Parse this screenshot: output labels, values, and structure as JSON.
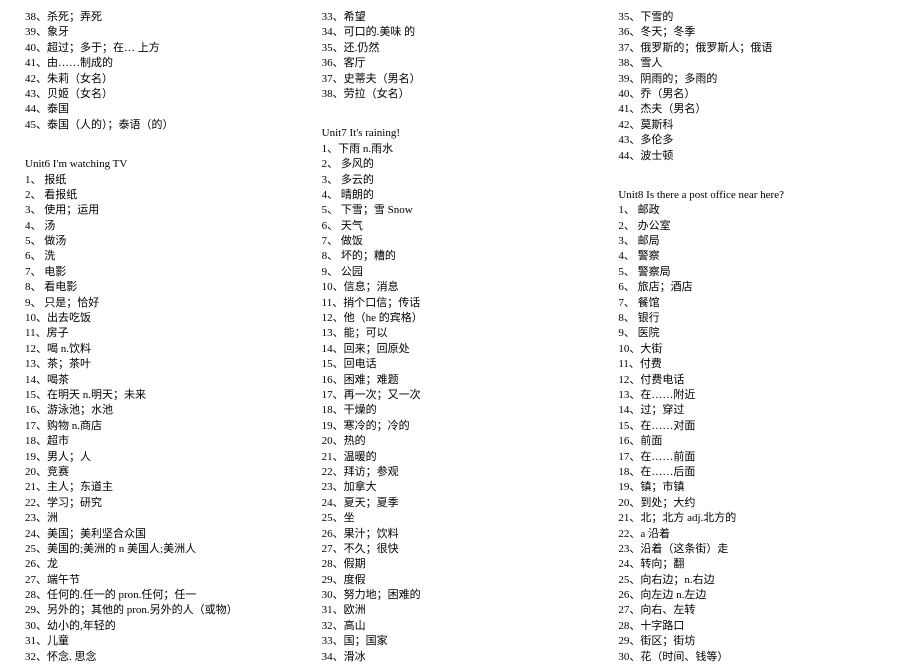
{
  "columns": [
    {
      "items": [
        {
          "type": "item",
          "text": "38、杀死；弄死"
        },
        {
          "type": "item",
          "text": "39、象牙"
        },
        {
          "type": "item",
          "text": "40、超过；多于；在… 上方"
        },
        {
          "type": "item",
          "text": "41、由……制成的"
        },
        {
          "type": "item",
          "text": "42、朱莉（女名）"
        },
        {
          "type": "item",
          "text": "43、贝姬（女名）"
        },
        {
          "type": "item",
          "text": "44、泰国"
        },
        {
          "type": "item",
          "text": "45、泰国（人的）；泰语（的）"
        },
        {
          "type": "spacer"
        },
        {
          "type": "unit",
          "text": "  Unit6   I'm watching TV"
        },
        {
          "type": "item",
          "text": "1、 报纸"
        },
        {
          "type": "item",
          "text": "2、 看报纸"
        },
        {
          "type": "item",
          "text": "3、 使用；运用"
        },
        {
          "type": "item",
          "text": "4、 汤"
        },
        {
          "type": "item",
          "text": "5、 做汤"
        },
        {
          "type": "item",
          "text": "6、 洗"
        },
        {
          "type": "item",
          "text": "7、 电影"
        },
        {
          "type": "item",
          "text": "8、 看电影"
        },
        {
          "type": "item",
          "text": "9、 只是；恰好"
        },
        {
          "type": "item",
          "text": "10、出去吃饭"
        },
        {
          "type": "item",
          "text": "11、房子"
        },
        {
          "type": "item",
          "text": "12、喝 n.饮料"
        },
        {
          "type": "item",
          "text": "13、茶；茶叶"
        },
        {
          "type": "item",
          "text": "14、喝茶"
        },
        {
          "type": "item",
          "text": "15、在明天   n.明天；未来"
        },
        {
          "type": "item",
          "text": "16、游泳池；水池"
        },
        {
          "type": "item",
          "text": "17、购物    n.商店"
        },
        {
          "type": "item",
          "text": "18、超市"
        },
        {
          "type": "item",
          "text": "19、男人；人"
        },
        {
          "type": "item",
          "text": "20、竞赛"
        },
        {
          "type": "item",
          "text": "21、主人；东道主"
        },
        {
          "type": "item",
          "text": "22、学习；研究"
        },
        {
          "type": "item",
          "text": "23、洲"
        },
        {
          "type": "item",
          "text": "24、美国；美利坚合众国"
        },
        {
          "type": "item",
          "text": "25、美国的;美洲的 n 美国人;美洲人"
        },
        {
          "type": "item",
          "text": "26、龙"
        },
        {
          "type": "item",
          "text": "27、端午节"
        },
        {
          "type": "item",
          "text": "28、任何的.任一的  pron.任何；任一"
        },
        {
          "type": "item",
          "text": "29、另外的；其他的 pron.另外的人（或物）"
        },
        {
          "type": "item",
          "text": "30、幼小的,年轻的"
        },
        {
          "type": "item",
          "text": "31、儿童"
        },
        {
          "type": "item",
          "text": "32、怀念. 思念"
        }
      ]
    },
    {
      "items": [
        {
          "type": "item",
          "text": "33、希望"
        },
        {
          "type": "item",
          "text": "34、可口的.美味 的"
        },
        {
          "type": "item",
          "text": "35、还.仍然"
        },
        {
          "type": "item",
          "text": "36、客厅"
        },
        {
          "type": "item",
          "text": "37、史蒂夫（男名）"
        },
        {
          "type": "item",
          "text": "38、劳拉（女名）"
        },
        {
          "type": "spacer"
        },
        {
          "type": "unit",
          "text": "Unit7    It's raining!"
        },
        {
          "type": "item",
          "text": "1、下雨 n.雨水"
        },
        {
          "type": "item",
          "text": "2、 多风的"
        },
        {
          "type": "item",
          "text": "3、 多云的"
        },
        {
          "type": "item",
          "text": "4、 晴朗的"
        },
        {
          "type": "item",
          "text": "5、 下雪；雪 Snow"
        },
        {
          "type": "item",
          "text": "6、 天气"
        },
        {
          "type": "item",
          "text": "7、 做饭"
        },
        {
          "type": "item",
          "text": "8、 坏的；糟的"
        },
        {
          "type": "item",
          "text": "9、 公园"
        },
        {
          "type": "item",
          "text": "10、信息；消息"
        },
        {
          "type": "item",
          "text": "11、捎个口信；传话"
        },
        {
          "type": "item",
          "text": "12、他（he 的宾格）"
        },
        {
          "type": "item",
          "text": "13、能；可以"
        },
        {
          "type": "item",
          "text": "14、回来；回原处"
        },
        {
          "type": "item",
          "text": "15、回电话"
        },
        {
          "type": "item",
          "text": "16、困难；难题"
        },
        {
          "type": "item",
          "text": "17、再一次；又一次"
        },
        {
          "type": "item",
          "text": "18、干燥的"
        },
        {
          "type": "item",
          "text": "19、寒冷的；冷的"
        },
        {
          "type": "item",
          "text": "20、热的"
        },
        {
          "type": "item",
          "text": "21、温暖的"
        },
        {
          "type": "item",
          "text": "22、拜访；参观"
        },
        {
          "type": "item",
          "text": "23、加拿大"
        },
        {
          "type": "item",
          "text": "24、夏天；夏季"
        },
        {
          "type": "item",
          "text": "25、坐"
        },
        {
          "type": "item",
          "text": "26、果汁；饮料"
        },
        {
          "type": "item",
          "text": "27、不久；很快"
        },
        {
          "type": "item",
          "text": "28、假期"
        },
        {
          "type": "item",
          "text": "29、度假"
        },
        {
          "type": "item",
          "text": "30、努力地；困难的"
        },
        {
          "type": "item",
          "text": "31、欧洲"
        },
        {
          "type": "item",
          "text": "32、高山"
        },
        {
          "type": "item",
          "text": "33、国；国家"
        },
        {
          "type": "item",
          "text": "34、滑冰"
        }
      ]
    },
    {
      "items": [
        {
          "type": "item",
          "text": "35、下雪的"
        },
        {
          "type": "item",
          "text": "36、冬天；冬季"
        },
        {
          "type": "item",
          "text": "37、俄罗斯的；俄罗斯人；俄语"
        },
        {
          "type": "item",
          "text": "38、雪人"
        },
        {
          "type": "item",
          "text": "39、阴雨的；多雨的"
        },
        {
          "type": "item",
          "text": "40、乔（男名）"
        },
        {
          "type": "item",
          "text": "41、杰夫（男名）"
        },
        {
          "type": "item",
          "text": "42、莫斯科"
        },
        {
          "type": "item",
          "text": "43、多伦多"
        },
        {
          "type": "item",
          "text": "44、波士顿"
        },
        {
          "type": "spacer"
        },
        {
          "type": "unit",
          "text": "Unit8    Is there a post office near here?"
        },
        {
          "type": "item",
          "text": "1、 邮政"
        },
        {
          "type": "item",
          "text": "2、 办公室"
        },
        {
          "type": "item",
          "text": "3、 邮局"
        },
        {
          "type": "item",
          "text": "4、 警察"
        },
        {
          "type": "item",
          "text": "5、 警察局"
        },
        {
          "type": "item",
          "text": "6、 旅店；酒店"
        },
        {
          "type": "item",
          "text": "7、 餐馆"
        },
        {
          "type": "item",
          "text": "8、 银行"
        },
        {
          "type": "item",
          "text": "9、 医院"
        },
        {
          "type": "item",
          "text": "10、大街"
        },
        {
          "type": "item",
          "text": "11、付费"
        },
        {
          "type": "item",
          "text": "12、付费电话"
        },
        {
          "type": "item",
          "text": "13、在……附近"
        },
        {
          "type": "item",
          "text": "14、过；穿过"
        },
        {
          "type": "item",
          "text": "15、在……对面"
        },
        {
          "type": "item",
          "text": "16、前面"
        },
        {
          "type": "item",
          "text": "17、在……前面"
        },
        {
          "type": "item",
          "text": "18、在……后面"
        },
        {
          "type": "item",
          "text": "19、镇；市镇"
        },
        {
          "type": "item",
          "text": "20、到处；大约"
        },
        {
          "type": "item",
          "text": "21、北；北方 adj.北方的"
        },
        {
          "type": "item",
          "text": "22、a 沿着"
        },
        {
          "type": "item",
          "text": "23、沿着（这条街）走"
        },
        {
          "type": "item",
          "text": "24、转向；翻"
        },
        {
          "type": "item",
          "text": "25、向右边；n.右边"
        },
        {
          "type": "item",
          "text": "26、向左边 n.左边"
        },
        {
          "type": "item",
          "text": "27、向右、左转"
        },
        {
          "type": "item",
          "text": "28、十字路口"
        },
        {
          "type": "item",
          "text": "29、街区；街坊"
        },
        {
          "type": "item",
          "text": "30、花（时间、钱等）"
        }
      ]
    }
  ]
}
